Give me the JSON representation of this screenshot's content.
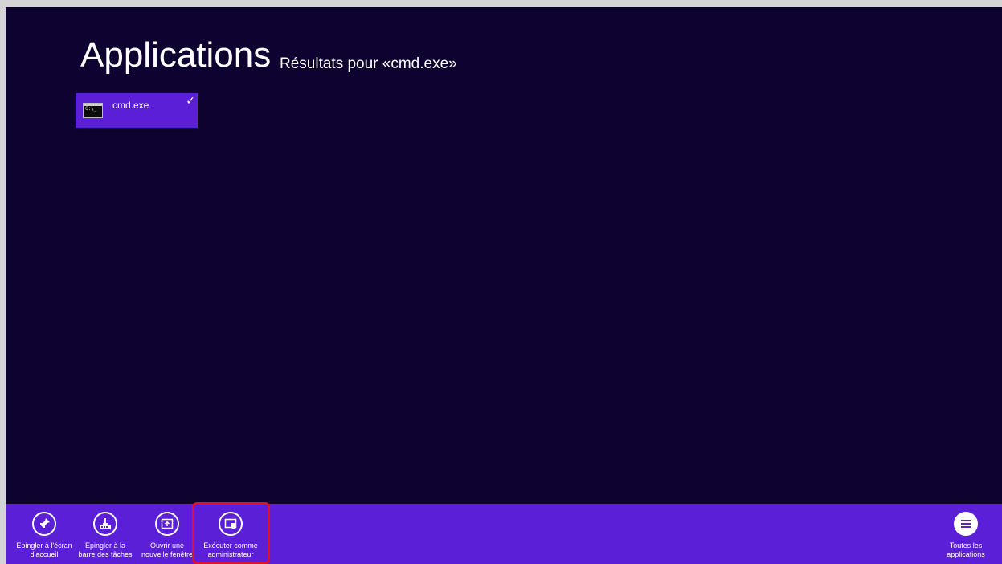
{
  "header": {
    "title": "Applications",
    "subtitle": "Résultats pour «cmd.exe»"
  },
  "results": [
    {
      "label": "cmd.exe",
      "icon": "cmd-window-icon",
      "selected": true
    }
  ],
  "appbar": {
    "commands": [
      {
        "line1": "Épingler à l'écran",
        "line2": "d'accueil",
        "icon": "pin-icon"
      },
      {
        "line1": "Épingler à la",
        "line2": "barre des tâches",
        "icon": "pin-taskbar-icon"
      },
      {
        "line1": "Ouvrir une",
        "line2": "nouvelle fenêtre",
        "icon": "new-window-icon"
      },
      {
        "line1": "Exécuter comme",
        "line2": "administrateur",
        "icon": "run-as-admin-shield-icon"
      }
    ],
    "right_command": {
      "line1": "Toutes les",
      "line2": "applications",
      "icon": "list-icon"
    }
  },
  "colors": {
    "background": "#0e0330",
    "accent": "#5c1fd8",
    "highlight": "#e0102a"
  }
}
